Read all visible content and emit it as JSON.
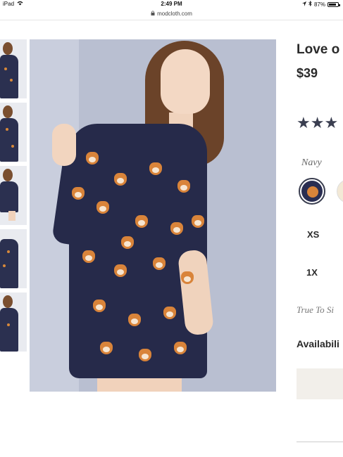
{
  "status_bar": {
    "device": "iPad",
    "time": "2:49 PM",
    "battery": "87%",
    "battery_level": 0.87
  },
  "browser": {
    "url": "modcloth.com"
  },
  "gallery": {
    "thumbnail_count": 5
  },
  "product": {
    "title": "Love o",
    "price": "$39",
    "rating_stars": "★★★",
    "color_label": "Navy",
    "sizes": [
      "XS",
      "1X"
    ],
    "fit_label": "True To Si",
    "availability_label": "Availabili"
  },
  "colors": {
    "dress_navy": "#262a4a",
    "corgi_orange": "#d9843a",
    "star_color": "#3a3e50",
    "button_bg": "#f2efea"
  }
}
